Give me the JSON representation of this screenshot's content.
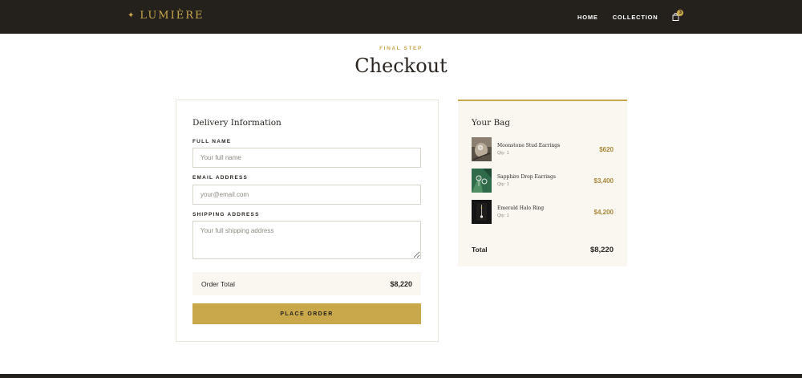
{
  "colors": {
    "nav_background": "#24201c",
    "gold_accent": "#c9a84c",
    "panel_background": "#faf7f1",
    "text_dark": "#2a2520"
  },
  "header": {
    "brand_icon": "sparkle-icon",
    "brand_name": "LUMIÈRE",
    "nav_items": [
      "HOME",
      "COLLECTION"
    ],
    "cart_icon": "shopping-bag-icon",
    "cart_count": "3"
  },
  "page": {
    "eyebrow": "FINAL STEP",
    "title": "Checkout"
  },
  "form": {
    "heading": "Delivery Information",
    "full_name_label": "FULL NAME",
    "full_name_placeholder": "Your full name",
    "full_name_value": "",
    "email_label": "EMAIL ADDRESS",
    "email_placeholder": "your@email.com",
    "email_value": "",
    "address_label": "SHIPPING ADDRESS",
    "address_placeholder": "Your full shipping address",
    "address_value": "",
    "order_total_label": "Order Total",
    "order_total_value": "$8,220",
    "submit_label": "PLACE ORDER"
  },
  "bag": {
    "heading": "Your Bag",
    "items": [
      {
        "name": "Moonstone Stud Earrings",
        "qty": "Qty: 1",
        "price": "$620"
      },
      {
        "name": "Sapphire Drop Earrings",
        "qty": "Qty: 1",
        "price": "$3,400"
      },
      {
        "name": "Emerald Halo Ring",
        "qty": "Qty: 1",
        "price": "$4,200"
      }
    ],
    "total_label": "Total",
    "total_value": "$8,220"
  }
}
